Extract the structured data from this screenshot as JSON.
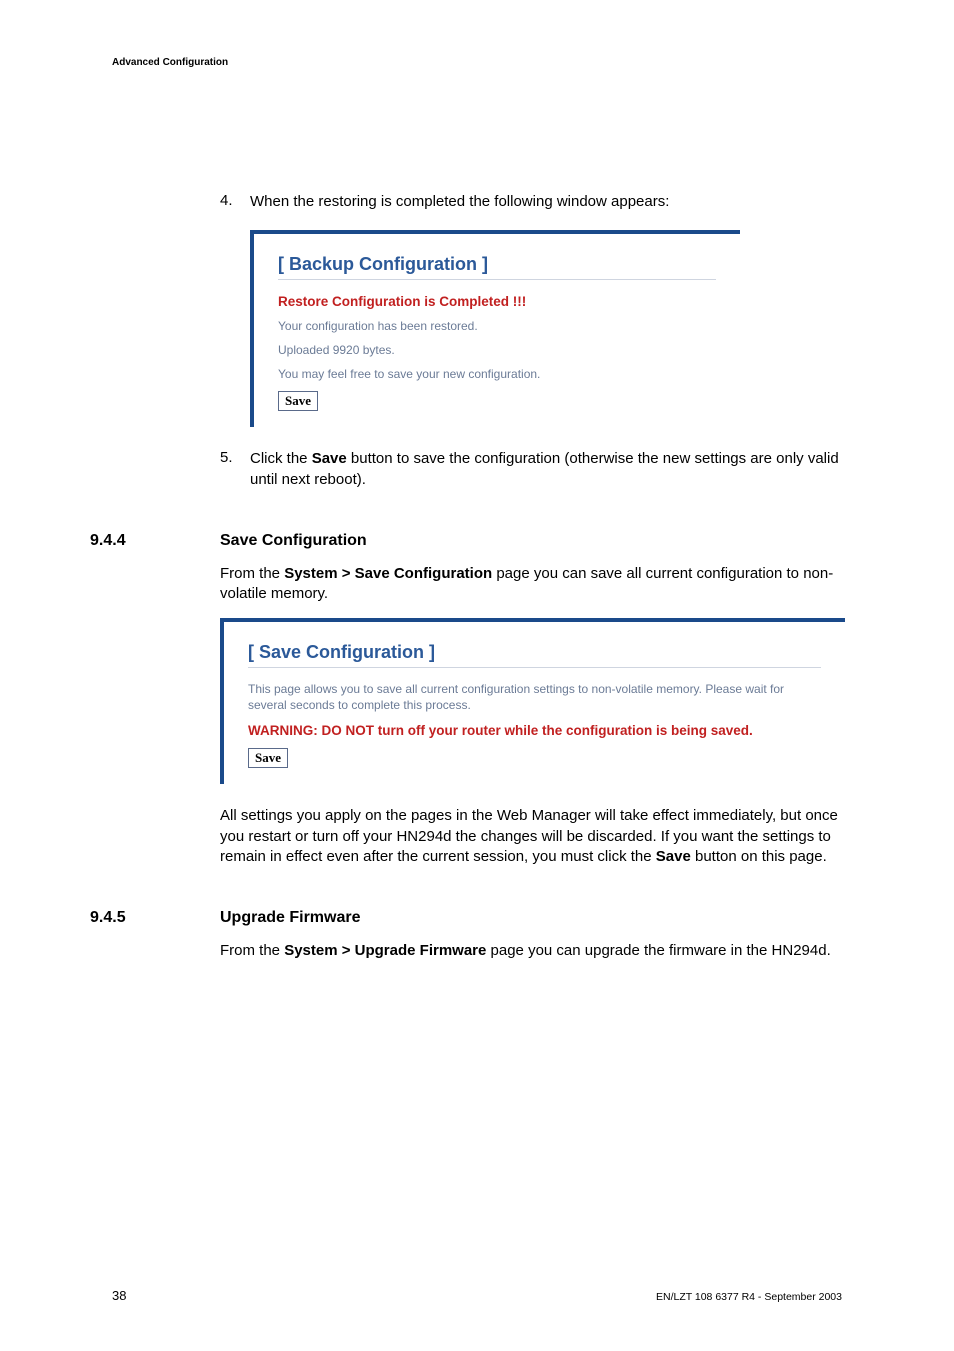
{
  "header": {
    "title": "Advanced Configuration"
  },
  "footer": {
    "page": "38",
    "doc_id": "EN/LZT 108 6377 R4 - September 2003"
  },
  "steps": {
    "four": {
      "num": "4.",
      "text": "When the restoring is completed the following window appears:"
    },
    "five": {
      "num": "5.",
      "prefix": "Click the ",
      "bold": "Save",
      "suffix": " button to save the configuration (otherwise the new settings are only valid until next reboot)."
    }
  },
  "backup_box": {
    "title": "[ Backup Configuration ]",
    "subtitle": "Restore Configuration is Completed !!!",
    "line1": "Your configuration has been restored.",
    "line2": "Uploaded 9920 bytes.",
    "line3": "You may feel free to save your new configuration.",
    "save_label": "Save"
  },
  "section_944": {
    "num": "9.4.4",
    "title": "Save Configuration",
    "intro_prefix": "From the ",
    "intro_bold": "System > Save Configuration",
    "intro_suffix": " page you can save all current configuration to non-volatile memory.",
    "outro_prefix": "All settings you apply on the pages in the Web Manager will take effect immediately, but once you restart or turn off your HN294d the changes will be discarded. If you want the settings to remain in effect even after the current session, you must click the ",
    "outro_bold": "Save",
    "outro_suffix": " button on this page."
  },
  "save_box": {
    "title": "[ Save Configuration ]",
    "line1": "This page allows you to save all current configuration settings to non-volatile memory.  Please wait for several seconds to complete this process.",
    "warning": "WARNING: DO NOT turn off your router while the configuration is being saved.",
    "save_label": "Save"
  },
  "section_945": {
    "num": "9.4.5",
    "title": "Upgrade Firmware",
    "intro_prefix": "From the ",
    "intro_bold": "System > Upgrade Firmware",
    "intro_suffix": " page you can upgrade the firmware in the HN294d."
  }
}
